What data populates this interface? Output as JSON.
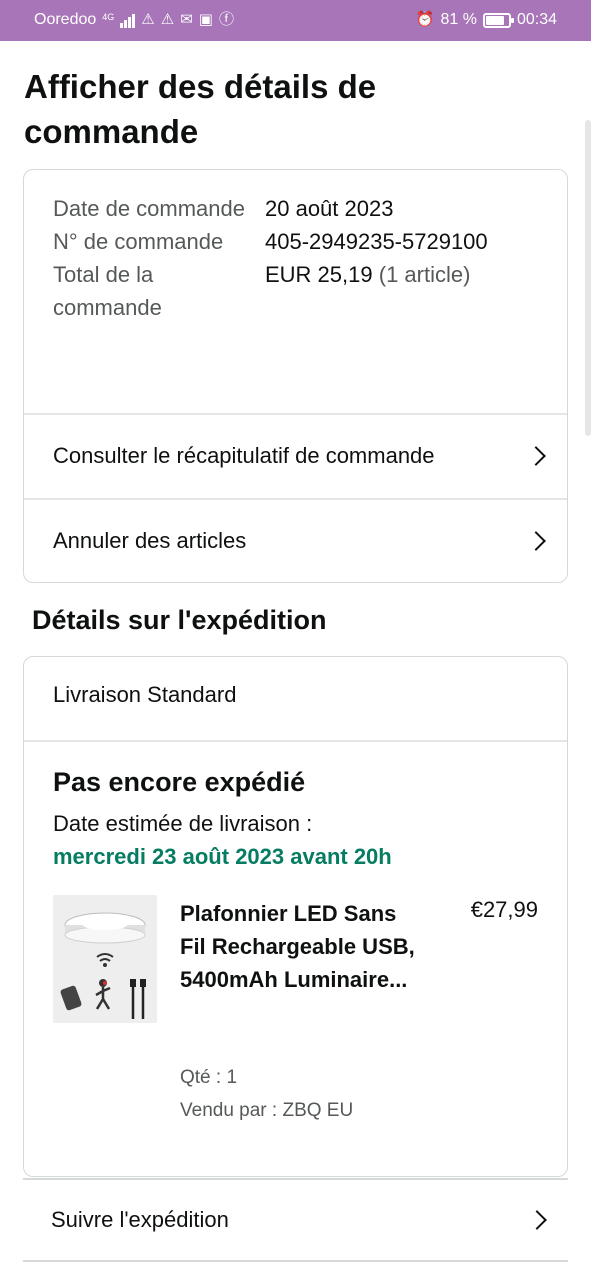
{
  "status_bar": {
    "carrier": "Ooredoo",
    "network": "4G",
    "battery_percent": "81 %",
    "battery_level": 0.81,
    "time": "00:34",
    "icons": [
      "signal-icon",
      "warning-icon",
      "warning-icon",
      "mail-icon",
      "app-icon",
      "facebook-icon",
      "alarm-icon",
      "battery-icon"
    ]
  },
  "page": {
    "title": "Afficher des détails de commande"
  },
  "order_summary": {
    "date_label": "Date de commande",
    "date_value": "20 août 2023",
    "number_label": "N° de commande",
    "number_value": "405-2949235-5729100",
    "total_label": "Total de la commande",
    "total_value": "EUR 25,19",
    "total_items": "(1 article)"
  },
  "links": {
    "view_summary": "Consulter le récapitulatif de commande",
    "cancel_items": "Annuler des articles",
    "track_shipment": "Suivre l'expédition"
  },
  "shipment": {
    "section_title": "Détails sur l'expédition",
    "method": "Livraison Standard",
    "status": "Pas encore expédié",
    "eta_label": "Date estimée de livraison :",
    "eta_value": "mercredi 23 août 2023 avant 20h",
    "eta_color": "#067d62"
  },
  "product": {
    "title": "Plafonnier LED Sans Fil Rechargeable USB, 5400mAh Luminaire...",
    "price": "€27,99",
    "qty": "Qté : 1",
    "seller": "Vendu par : ZBQ EU"
  },
  "colors": {
    "status_bar_bg": "#a775b8",
    "text": "#0f1111",
    "muted": "#565959",
    "border": "#d5d9d9"
  }
}
